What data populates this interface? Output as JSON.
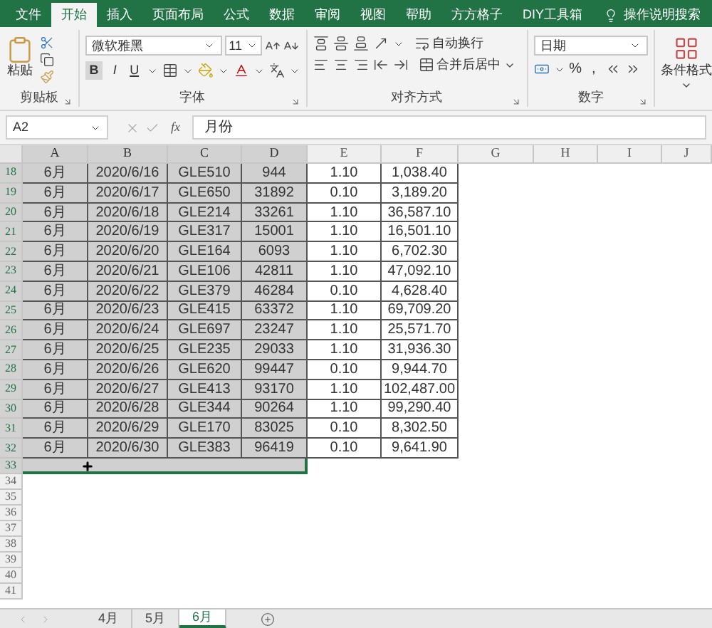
{
  "ribbon_tabs": [
    {
      "label": "文件",
      "selected": false
    },
    {
      "label": "开始",
      "selected": true
    },
    {
      "label": "插入",
      "selected": false
    },
    {
      "label": "页面布局",
      "selected": false
    },
    {
      "label": "公式",
      "selected": false
    },
    {
      "label": "数据",
      "selected": false
    },
    {
      "label": "审阅",
      "selected": false
    },
    {
      "label": "视图",
      "selected": false
    },
    {
      "label": "帮助",
      "selected": false
    },
    {
      "label": "方方格子",
      "selected": false
    },
    {
      "label": "DIY工具箱",
      "selected": false
    }
  ],
  "search": {
    "label": "操作说明搜索"
  },
  "ribbon": {
    "clipboard": {
      "paste": "粘贴",
      "group": "剪贴板"
    },
    "font": {
      "name": "微软雅黑",
      "size": "11",
      "bold": "B",
      "italic": "I",
      "underline": "U",
      "group": "字体"
    },
    "alignment": {
      "wrap": "自动换行",
      "merge": "合并后居中",
      "group": "对齐方式"
    },
    "number": {
      "format": "日期",
      "percent": "%",
      "comma": ",",
      "group": "数字"
    },
    "styles": {
      "conditional": "条件格式"
    }
  },
  "name_box": "A2",
  "formula_bar": {
    "fx": "fx",
    "value": "月份"
  },
  "columns": [
    {
      "label": "A",
      "selected": true
    },
    {
      "label": "B",
      "selected": true
    },
    {
      "label": "C",
      "selected": true
    },
    {
      "label": "D",
      "selected": true
    },
    {
      "label": "E",
      "selected": false
    },
    {
      "label": "F",
      "selected": false
    },
    {
      "label": "G",
      "selected": false
    },
    {
      "label": "H",
      "selected": false
    },
    {
      "label": "I",
      "selected": false
    },
    {
      "label": "J",
      "selected": false
    }
  ],
  "rows": [
    {
      "number": "18",
      "selected": true,
      "cells": [
        "6月",
        "2020/6/16",
        "GLE510",
        "944",
        "1.10",
        "1,038.40"
      ]
    },
    {
      "number": "19",
      "selected": true,
      "cells": [
        "6月",
        "2020/6/17",
        "GLE650",
        "31892",
        "0.10",
        "3,189.20"
      ]
    },
    {
      "number": "20",
      "selected": true,
      "cells": [
        "6月",
        "2020/6/18",
        "GLE214",
        "33261",
        "1.10",
        "36,587.10"
      ]
    },
    {
      "number": "21",
      "selected": true,
      "cells": [
        "6月",
        "2020/6/19",
        "GLE317",
        "15001",
        "1.10",
        "16,501.10"
      ]
    },
    {
      "number": "22",
      "selected": true,
      "cells": [
        "6月",
        "2020/6/20",
        "GLE164",
        "6093",
        "1.10",
        "6,702.30"
      ]
    },
    {
      "number": "23",
      "selected": true,
      "cells": [
        "6月",
        "2020/6/21",
        "GLE106",
        "42811",
        "1.10",
        "47,092.10"
      ]
    },
    {
      "number": "24",
      "selected": true,
      "cells": [
        "6月",
        "2020/6/22",
        "GLE379",
        "46284",
        "0.10",
        "4,628.40"
      ]
    },
    {
      "number": "25",
      "selected": true,
      "cells": [
        "6月",
        "2020/6/23",
        "GLE415",
        "63372",
        "1.10",
        "69,709.20"
      ]
    },
    {
      "number": "26",
      "selected": true,
      "cells": [
        "6月",
        "2020/6/24",
        "GLE697",
        "23247",
        "1.10",
        "25,571.70"
      ]
    },
    {
      "number": "27",
      "selected": true,
      "cells": [
        "6月",
        "2020/6/25",
        "GLE235",
        "29033",
        "1.10",
        "31,936.30"
      ]
    },
    {
      "number": "28",
      "selected": true,
      "cells": [
        "6月",
        "2020/6/26",
        "GLE620",
        "99447",
        "0.10",
        "9,944.70"
      ]
    },
    {
      "number": "29",
      "selected": true,
      "cells": [
        "6月",
        "2020/6/27",
        "GLE413",
        "93170",
        "1.10",
        "102,487.00"
      ]
    },
    {
      "number": "30",
      "selected": true,
      "cells": [
        "6月",
        "2020/6/28",
        "GLE344",
        "90264",
        "1.10",
        "99,290.40"
      ]
    },
    {
      "number": "31",
      "selected": true,
      "cells": [
        "6月",
        "2020/6/29",
        "GLE170",
        "83025",
        "0.10",
        "8,302.50"
      ]
    },
    {
      "number": "32",
      "selected": true,
      "cells": [
        "6月",
        "2020/6/30",
        "GLE383",
        "96419",
        "0.10",
        "9,641.90"
      ]
    },
    {
      "number": "33",
      "selected": true,
      "cursor": true
    },
    {
      "number": "34",
      "selected": false
    },
    {
      "number": "35",
      "selected": false
    },
    {
      "number": "36",
      "selected": false
    },
    {
      "number": "37",
      "selected": false
    },
    {
      "number": "38",
      "selected": false
    },
    {
      "number": "39",
      "selected": false
    },
    {
      "number": "40",
      "selected": false
    },
    {
      "number": "41",
      "selected": false
    }
  ],
  "sheet_tabs": [
    {
      "label": "4月",
      "selected": false
    },
    {
      "label": "5月",
      "selected": false
    },
    {
      "label": "6月",
      "selected": true
    }
  ]
}
